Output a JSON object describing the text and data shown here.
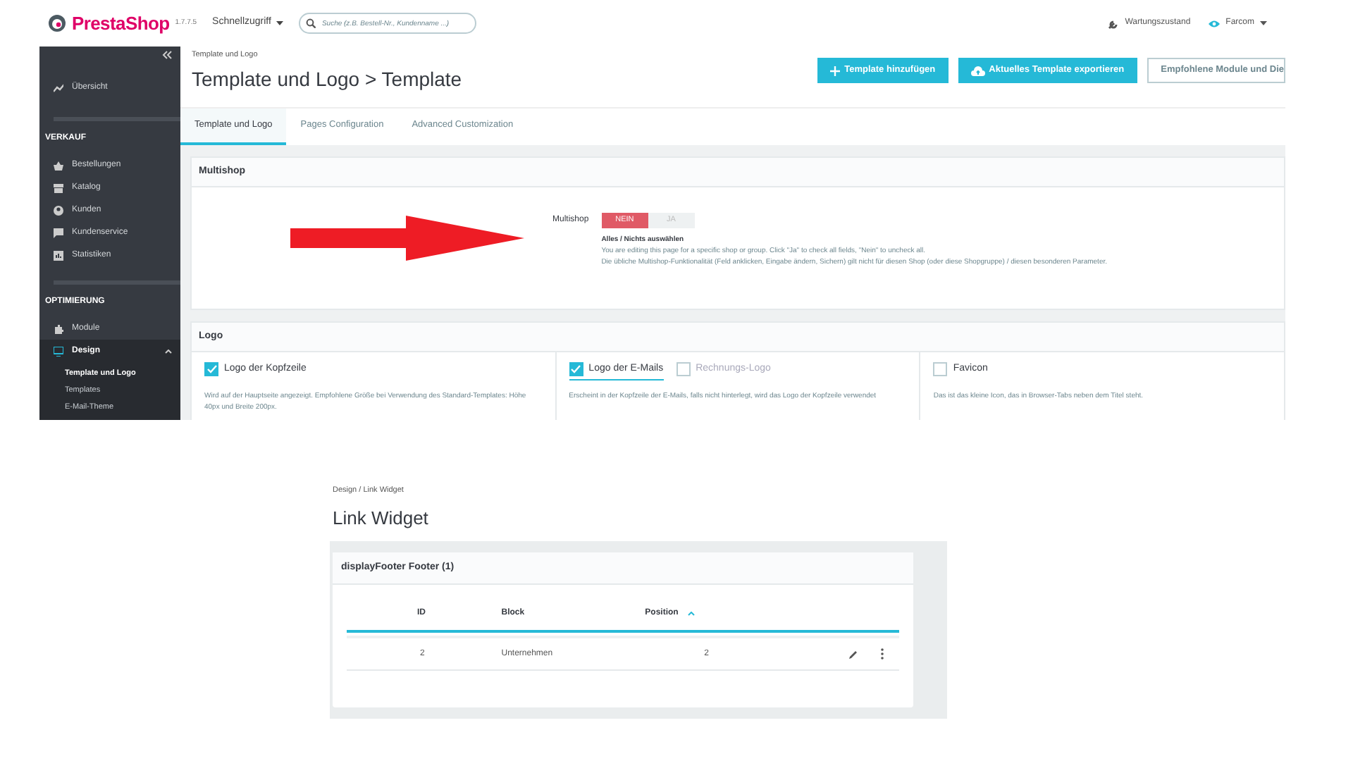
{
  "app": {
    "logo": "PrestaShop",
    "version": "1.7.7.5",
    "quick_access": "Schnellzugriff",
    "search": {
      "placeholder": "Suche (z.B. Bestell-Nr., Kundenname ...)"
    },
    "maintenance": "Wartungszustand",
    "shop": "Farcom"
  },
  "sidebar": {
    "top_items": [
      {
        "label": "Übersicht",
        "selected": false
      }
    ],
    "sections": [
      {
        "title": "VERKAUF",
        "items": [
          {
            "label": "Bestellungen",
            "selected": false,
            "expanded": false
          },
          {
            "label": "Katalog",
            "selected": false,
            "expanded": false
          },
          {
            "label": "Kunden",
            "selected": false,
            "expanded": false
          },
          {
            "label": "Kundenservice",
            "selected": false,
            "expanded": false
          },
          {
            "label": "Statistiken",
            "selected": false,
            "expanded": false
          }
        ]
      },
      {
        "title": "OPTIMIERUNG",
        "items": [
          {
            "label": "Module",
            "selected": false,
            "expanded": false
          },
          {
            "label": "Design",
            "selected": true,
            "expanded": true,
            "children": [
              {
                "label": "Template und Logo",
                "selected": true
              },
              {
                "label": "Templates",
                "selected": false
              },
              {
                "label": "E-Mail-Theme",
                "selected": false
              }
            ]
          }
        ]
      }
    ]
  },
  "page": {
    "breadcrumb": "Template und Logo",
    "title": "Template und Logo > Template",
    "buttons": [
      {
        "label": "Template hinzufügen",
        "kind": "add"
      },
      {
        "label": "Aktuelles Template exportieren",
        "kind": "export"
      },
      {
        "label": "Empfohlene Module und Die",
        "kind": "outline"
      }
    ],
    "tabs": [
      {
        "label": "Template und Logo",
        "selected": true
      },
      {
        "label": "Pages Configuration",
        "selected": false
      },
      {
        "label": "Advanced Customization",
        "selected": false
      }
    ]
  },
  "multishop_panel": {
    "title": "Multishop",
    "label": "Multishop",
    "toggle": [
      {
        "label": "NEIN",
        "selected": true
      },
      {
        "label": "JA",
        "selected": false
      }
    ],
    "help_title": "Alles / Nichts auswählen",
    "help_lines": [
      "You are editing this page for a specific shop or group. Click \"Ja\" to check all fields, \"Nein\" to uncheck all.",
      "Die übliche Multishop-Funktionalität (Feld anklicken, Eingabe ändern, Sichern) gilt nicht für diesen Shop (oder diese Shopgruppe) / diesen besonderen Parameter."
    ]
  },
  "logo_panel": {
    "title": "Logo",
    "columns": [
      {
        "options": [
          {
            "label": "Logo der Kopfzeile",
            "checked": true
          }
        ],
        "description": "Wird auf der Hauptseite angezeigt. Empfohlene Größe bei Verwendung des Standard-Templates: Höhe 40px und Breite 200px."
      },
      {
        "options": [
          {
            "label": "Logo der E-Mails",
            "checked": true,
            "selected": true
          },
          {
            "label": "Rechnungs-Logo",
            "checked": false,
            "selected": false
          }
        ],
        "description": "Erscheint in der Kopfzeile der E-Mails, falls nicht hinterlegt, wird das Logo der Kopfzeile verwendet"
      },
      {
        "options": [
          {
            "label": "Favicon",
            "checked": false
          }
        ],
        "description": "Das ist das kleine Icon, das in Browser-Tabs neben dem Titel steht."
      }
    ]
  },
  "link_widget": {
    "breadcrumb": "Design /  Link Widget",
    "title": "Link Widget",
    "card_title": "displayFooter Footer (1)",
    "columns": [
      {
        "label": "ID",
        "sorted": false
      },
      {
        "label": "Block",
        "sorted": false
      },
      {
        "label": "Position",
        "sorted": true
      }
    ],
    "rows": [
      {
        "cells": [
          "2",
          "Unternehmen",
          "2"
        ]
      }
    ]
  }
}
